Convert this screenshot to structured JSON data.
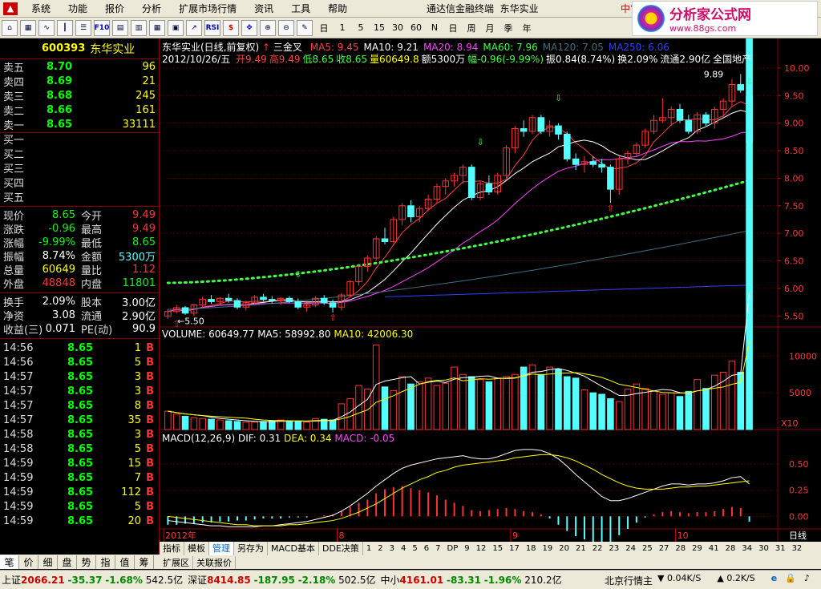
{
  "menubar": {
    "items": [
      "系统",
      "功能",
      "报价",
      "分析",
      "扩展市场行情",
      "资讯",
      "工具",
      "帮助"
    ],
    "app_title": "通达信金融终端",
    "stock_title": "东华实业",
    "ime": "中°。",
    "brand_name": "分析家公式网",
    "brand_url": "www.88gs.com"
  },
  "toolbar": {
    "periods": [
      "日",
      "1",
      "5",
      "15",
      "30",
      "60",
      "N",
      "日",
      "周",
      "月",
      "季",
      "年"
    ]
  },
  "stock": {
    "code": "600393",
    "name": "东华实业"
  },
  "order_book": {
    "asks": [
      {
        "label": "卖五",
        "price": "8.70",
        "volume": "96"
      },
      {
        "label": "卖四",
        "price": "8.69",
        "volume": "21"
      },
      {
        "label": "卖三",
        "price": "8.68",
        "volume": "245"
      },
      {
        "label": "卖二",
        "price": "8.66",
        "volume": "161"
      },
      {
        "label": "卖一",
        "price": "8.65",
        "volume": "33111"
      }
    ],
    "bids": [
      {
        "label": "买一",
        "price": "",
        "volume": ""
      },
      {
        "label": "买二",
        "price": "",
        "volume": ""
      },
      {
        "label": "买三",
        "price": "",
        "volume": ""
      },
      {
        "label": "买四",
        "price": "",
        "volume": ""
      },
      {
        "label": "买五",
        "price": "",
        "volume": ""
      }
    ]
  },
  "quote": [
    {
      "l1": "现价",
      "v1": "8.65",
      "c1": "green",
      "l2": "今开",
      "v2": "9.49",
      "c2": "red"
    },
    {
      "l1": "涨跌",
      "v1": "-0.96",
      "c1": "green",
      "l2": "最高",
      "v2": "9.49",
      "c2": "red"
    },
    {
      "l1": "涨幅",
      "v1": "-9.99%",
      "c1": "green",
      "l2": "最低",
      "v2": "8.65",
      "c2": "green"
    },
    {
      "l1": "振幅",
      "v1": "8.74%",
      "c1": "white",
      "l2": "金额",
      "v2": "5300万",
      "c2": "cyan"
    },
    {
      "l1": "总量",
      "v1": "60649",
      "c1": "yellow",
      "l2": "量比",
      "v2": "1.12",
      "c2": "red"
    },
    {
      "l1": "外盘",
      "v1": "48848",
      "c1": "red",
      "l2": "内盘",
      "v2": "11801",
      "c2": "green"
    }
  ],
  "fundamentals": [
    {
      "l1": "换手",
      "v1": "2.09%",
      "l2": "股本",
      "v2": "3.00亿"
    },
    {
      "l1": "净资",
      "v1": "3.08",
      "l2": "流通",
      "v2": "2.90亿"
    },
    {
      "l1": "收益(三)",
      "v1": "0.071",
      "l2": "PE(动)",
      "v2": "90.9"
    }
  ],
  "ticks": [
    {
      "time": "14:56",
      "price": "8.65",
      "vol": "1",
      "dir": "B"
    },
    {
      "time": "14:56",
      "price": "8.65",
      "vol": "5",
      "dir": "B"
    },
    {
      "time": "14:57",
      "price": "8.65",
      "vol": "3",
      "dir": "B"
    },
    {
      "time": "14:57",
      "price": "8.65",
      "vol": "3",
      "dir": "B"
    },
    {
      "time": "14:57",
      "price": "8.65",
      "vol": "8",
      "dir": "B"
    },
    {
      "time": "14:57",
      "price": "8.65",
      "vol": "35",
      "dir": "B"
    },
    {
      "time": "14:58",
      "price": "8.65",
      "vol": "3",
      "dir": "B"
    },
    {
      "time": "14:58",
      "price": "8.65",
      "vol": "5",
      "dir": "B"
    },
    {
      "time": "14:59",
      "price": "8.65",
      "vol": "15",
      "dir": "B"
    },
    {
      "time": "14:59",
      "price": "8.65",
      "vol": "7",
      "dir": "B"
    },
    {
      "time": "14:59",
      "price": "8.65",
      "vol": "112",
      "dir": "B"
    },
    {
      "time": "14:59",
      "price": "8.65",
      "vol": "5",
      "dir": "B"
    },
    {
      "time": "14:59",
      "price": "8.65",
      "vol": "20",
      "dir": "B"
    }
  ],
  "left_tabs": [
    "笔",
    "价",
    "细",
    "盘",
    "势",
    "指",
    "值",
    "筹"
  ],
  "chart": {
    "title": "东华实业(日线,前复权)",
    "signal": "三金叉",
    "ma": [
      {
        "label": "MA5: 9.45",
        "color": "#ff4040"
      },
      {
        "label": "MA10: 9.21",
        "color": "#ffffff"
      },
      {
        "label": "MA20: 8.94",
        "color": "#ff40ff"
      },
      {
        "label": "MA60: 7.96",
        "color": "#40ff40"
      },
      {
        "label": "MA120: 7.05",
        "color": "#407080"
      },
      {
        "label": "MA250: 6.06",
        "color": "#3040ff"
      }
    ],
    "info_date": "2012/10/26/五",
    "info": [
      {
        "t": "开9.49",
        "c": "#ff4040"
      },
      {
        "t": "高9.49",
        "c": "#ff4040"
      },
      {
        "t": "低8.65",
        "c": "#40ff40"
      },
      {
        "t": "收8.65",
        "c": "#40ff40"
      },
      {
        "t": "量60649.8",
        "c": "#ffff00"
      },
      {
        "t": "额5300万",
        "c": "#ffffff"
      },
      {
        "t": "幅-0.96(-9.99%)",
        "c": "#40ff40"
      },
      {
        "t": "振0.84(8.74%)",
        "c": "#ffffff"
      },
      {
        "t": "换2.09%",
        "c": "#ffffff"
      },
      {
        "t": "流通2.90亿",
        "c": "#ffffff"
      },
      {
        "t": "全国地产",
        "c": "#ffffff"
      }
    ],
    "high_label": "9.89",
    "low_label": "5.50",
    "price_axis": [
      "10.00",
      "9.50",
      "9.00",
      "8.50",
      "8.00",
      "7.50",
      "7.00",
      "6.50",
      "6.00",
      "5.50"
    ],
    "volume_title": "VOLUME: 60649.77",
    "volume_ma5": "MA5: 58992.80",
    "volume_ma10": "MA10: 42006.30",
    "volume_axis": [
      "10000",
      "5000"
    ],
    "volume_unit": "X10",
    "macd_title": "MACD(12,26,9)",
    "macd_dif": "DIF: 0.31",
    "macd_dea": "DEA: 0.34",
    "macd_val": "MACD: -0.05",
    "macd_axis": [
      "0.50",
      "0.25",
      "0.00"
    ],
    "date_axis": [
      "2012年",
      "8",
      "9",
      "10"
    ],
    "period_label": "日线"
  },
  "chart_data": {
    "type": "candlestick",
    "title": "东华实业(日线,前复权)",
    "ylim": [
      5.3,
      10.1
    ],
    "candles": [
      [
        5.5,
        5.62,
        5.45,
        5.58
      ],
      [
        5.58,
        5.7,
        5.55,
        5.65
      ],
      [
        5.65,
        5.68,
        5.52,
        5.55
      ],
      [
        5.55,
        5.72,
        5.5,
        5.7
      ],
      [
        5.7,
        5.85,
        5.66,
        5.8
      ],
      [
        5.8,
        5.88,
        5.72,
        5.76
      ],
      [
        5.76,
        5.84,
        5.7,
        5.82
      ],
      [
        5.82,
        5.9,
        5.74,
        5.78
      ],
      [
        5.78,
        5.82,
        5.62,
        5.66
      ],
      [
        5.66,
        5.78,
        5.6,
        5.74
      ],
      [
        5.74,
        5.88,
        5.7,
        5.84
      ],
      [
        5.84,
        5.9,
        5.76,
        5.8
      ],
      [
        5.8,
        5.86,
        5.72,
        5.78
      ],
      [
        5.78,
        5.84,
        5.7,
        5.82
      ],
      [
        5.82,
        5.86,
        5.74,
        5.76
      ],
      [
        5.76,
        5.82,
        5.62,
        5.66
      ],
      [
        5.66,
        5.72,
        5.58,
        5.7
      ],
      [
        5.7,
        5.86,
        5.66,
        5.82
      ],
      [
        5.82,
        5.88,
        5.7,
        5.74
      ],
      [
        5.74,
        5.8,
        5.56,
        5.66
      ],
      [
        5.66,
        5.92,
        5.6,
        5.88
      ],
      [
        5.88,
        6.15,
        5.85,
        6.12
      ],
      [
        6.12,
        6.45,
        6.05,
        6.4
      ],
      [
        6.4,
        6.6,
        6.3,
        6.55
      ],
      [
        6.55,
        6.95,
        6.5,
        6.9
      ],
      [
        6.9,
        7.1,
        6.8,
        6.85
      ],
      [
        6.85,
        7.3,
        6.82,
        7.25
      ],
      [
        7.25,
        7.55,
        7.15,
        7.5
      ],
      [
        7.5,
        7.6,
        7.2,
        7.3
      ],
      [
        7.3,
        7.5,
        7.2,
        7.45
      ],
      [
        7.45,
        7.7,
        7.4,
        7.62
      ],
      [
        7.62,
        7.9,
        7.55,
        7.85
      ],
      [
        7.85,
        8.0,
        7.7,
        7.95
      ],
      [
        7.95,
        8.1,
        7.85,
        8.05
      ],
      [
        8.05,
        8.25,
        7.9,
        8.2
      ],
      [
        8.2,
        8.25,
        7.6,
        7.65
      ],
      [
        7.65,
        7.95,
        7.6,
        7.9
      ],
      [
        7.9,
        8.05,
        7.7,
        7.75
      ],
      [
        7.75,
        8.1,
        7.7,
        8.05
      ],
      [
        8.05,
        8.6,
        8.0,
        8.55
      ],
      [
        8.55,
        8.95,
        8.45,
        8.9
      ],
      [
        8.9,
        9.05,
        8.75,
        8.85
      ],
      [
        8.85,
        9.15,
        8.8,
        9.1
      ],
      [
        9.1,
        9.15,
        8.8,
        8.85
      ],
      [
        8.85,
        9.05,
        8.75,
        8.95
      ],
      [
        8.95,
        9.0,
        8.7,
        8.8
      ],
      [
        8.8,
        8.85,
        8.3,
        8.35
      ],
      [
        8.35,
        8.45,
        8.15,
        8.25
      ],
      [
        8.25,
        8.4,
        8.1,
        8.3
      ],
      [
        8.3,
        8.4,
        8.2,
        8.25
      ],
      [
        8.25,
        8.35,
        8.1,
        8.2
      ],
      [
        8.2,
        8.25,
        7.55,
        7.8
      ],
      [
        7.8,
        8.4,
        7.7,
        8.35
      ],
      [
        8.35,
        8.5,
        8.25,
        8.45
      ],
      [
        8.45,
        8.65,
        8.4,
        8.6
      ],
      [
        8.6,
        8.9,
        8.55,
        8.85
      ],
      [
        8.85,
        9.15,
        8.8,
        9.05
      ],
      [
        9.05,
        9.45,
        9.0,
        9.1
      ],
      [
        9.1,
        9.3,
        8.95,
        9.25
      ],
      [
        9.25,
        9.35,
        9.0,
        9.05
      ],
      [
        9.05,
        9.15,
        8.8,
        8.85
      ],
      [
        8.85,
        9.2,
        8.8,
        9.15
      ],
      [
        9.15,
        9.2,
        8.95,
        9.0
      ],
      [
        9.0,
        9.3,
        8.9,
        9.25
      ],
      [
        9.25,
        9.45,
        9.1,
        9.4
      ],
      [
        9.4,
        9.8,
        9.3,
        9.7
      ],
      [
        9.7,
        9.89,
        9.55,
        9.6
      ],
      [
        9.49,
        9.49,
        8.65,
        8.65
      ]
    ],
    "volume": [
      250,
      210,
      180,
      160,
      150,
      140,
      130,
      120,
      110,
      100,
      100,
      110,
      120,
      130,
      120,
      110,
      100,
      150,
      140,
      130,
      350,
      420,
      600,
      550,
      1150,
      580,
      530,
      720,
      620,
      650,
      700,
      600,
      630,
      850,
      750,
      720,
      680,
      650,
      700,
      720,
      750,
      850,
      880,
      750,
      850,
      820,
      720,
      700,
      540,
      500,
      480,
      420,
      380,
      550,
      620,
      560,
      520,
      480,
      500,
      450,
      520,
      680,
      560,
      740,
      780,
      930,
      780,
      6065
    ],
    "macd_hist": [
      -0.08,
      -0.08,
      -0.07,
      -0.07,
      -0.06,
      -0.06,
      -0.05,
      -0.05,
      -0.04,
      -0.04,
      -0.03,
      -0.02,
      -0.02,
      -0.02,
      -0.01,
      -0.01,
      -0.01,
      0.0,
      0.01,
      0.02,
      0.05,
      0.09,
      0.13,
      0.16,
      0.22,
      0.26,
      0.28,
      0.29,
      0.27,
      0.25,
      0.23,
      0.2,
      0.16,
      0.13,
      0.1,
      0.06,
      0.05,
      0.06,
      0.07,
      0.08,
      0.07,
      0.05,
      0.04,
      0.02,
      -0.02,
      -0.08,
      -0.14,
      -0.19,
      -0.22,
      -0.25,
      -0.28,
      -0.25,
      -0.18,
      -0.12,
      -0.06,
      -0.01,
      0.02,
      0.04,
      0.05,
      0.04,
      0.03,
      0.04,
      0.04,
      0.05,
      0.07,
      0.09,
      0.08,
      -0.05
    ],
    "dif": [
      -0.04,
      -0.05,
      -0.06,
      -0.07,
      -0.08,
      -0.09,
      -0.09,
      -0.1,
      -0.1,
      -0.1,
      -0.1,
      -0.09,
      -0.09,
      -0.08,
      -0.07,
      -0.06,
      -0.05,
      -0.03,
      -0.01,
      0.01,
      0.05,
      0.1,
      0.16,
      0.22,
      0.29,
      0.35,
      0.41,
      0.46,
      0.49,
      0.51,
      0.53,
      0.55,
      0.56,
      0.57,
      0.58,
      0.56,
      0.55,
      0.55,
      0.57,
      0.6,
      0.63,
      0.64,
      0.64,
      0.63,
      0.6,
      0.55,
      0.48,
      0.4,
      0.33,
      0.26,
      0.19,
      0.15,
      0.15,
      0.17,
      0.2,
      0.23,
      0.26,
      0.29,
      0.31,
      0.31,
      0.3,
      0.31,
      0.31,
      0.32,
      0.34,
      0.37,
      0.38,
      0.31
    ],
    "dea": [
      0.0,
      -0.01,
      -0.02,
      -0.03,
      -0.04,
      -0.05,
      -0.06,
      -0.07,
      -0.08,
      -0.08,
      -0.09,
      -0.09,
      -0.09,
      -0.09,
      -0.08,
      -0.08,
      -0.07,
      -0.06,
      -0.05,
      -0.04,
      -0.02,
      0.01,
      0.04,
      0.08,
      0.12,
      0.17,
      0.22,
      0.27,
      0.31,
      0.35,
      0.38,
      0.42,
      0.44,
      0.47,
      0.49,
      0.5,
      0.51,
      0.52,
      0.53,
      0.54,
      0.56,
      0.57,
      0.58,
      0.59,
      0.59,
      0.58,
      0.56,
      0.53,
      0.49,
      0.45,
      0.4,
      0.36,
      0.32,
      0.29,
      0.27,
      0.26,
      0.26,
      0.26,
      0.27,
      0.28,
      0.28,
      0.29,
      0.29,
      0.3,
      0.31,
      0.32,
      0.33,
      0.34
    ]
  },
  "bottom_tabs": [
    "指标",
    "模板",
    "管理",
    "另存为",
    "MACD基本",
    "DDE决策"
  ],
  "bottom_nums": [
    "1",
    "2",
    "3",
    "4",
    "5",
    "6",
    "7",
    "DP",
    "9",
    "12",
    "15",
    "17",
    "18",
    "19",
    "20",
    "21",
    "22",
    "23",
    "24",
    "25",
    "27",
    "28",
    "29",
    "41",
    "28",
    "34",
    "30",
    "31",
    "32"
  ],
  "ext_tabs": [
    "扩展区",
    "关联报价"
  ],
  "status": {
    "sh_label": "上证",
    "sh_val": "2066.21",
    "sh_chg": "-35.37",
    "sh_pct": "-1.68%",
    "sh_amt": "542.5亿",
    "sz_label": "深证",
    "sz_val": "8414.85",
    "sz_chg": "-187.95",
    "sz_pct": "-2.18%",
    "sz_amt": "502.5亿",
    "zx_label": "中小",
    "zx_val": "4161.01",
    "zx_chg": "-83.31",
    "zx_pct": "-1.96%",
    "zx_amt": "210.2亿",
    "news": "北京行情主",
    "net1": "0.04K/S",
    "net2": "0.2K/S"
  }
}
